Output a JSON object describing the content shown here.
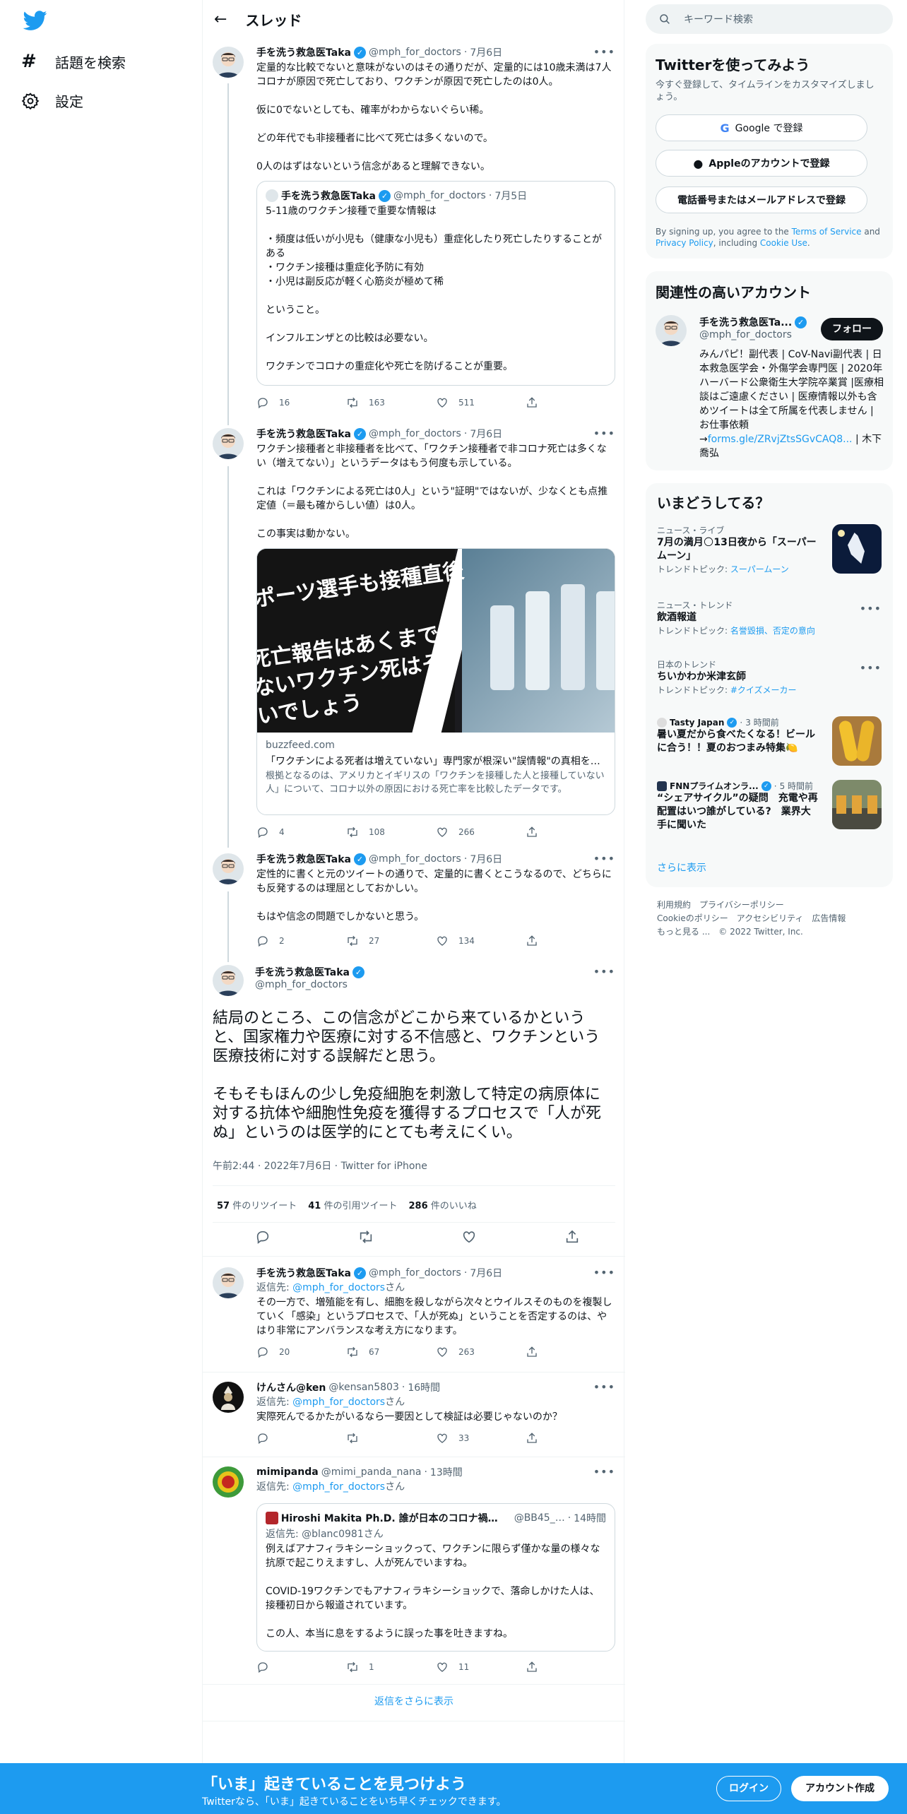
{
  "sidebar": {
    "explore_label": "話題を検索",
    "settings_label": "設定"
  },
  "header": {
    "title": "スレッド"
  },
  "search": {
    "placeholder": "キーワード検索"
  },
  "tweets": [
    {
      "name": "手を洗う救急医Taka",
      "handle": "@mph_for_doctors",
      "date": "7月6日",
      "text": "定量的な比較でないと意味がないのはその通りだが、定量的には10歳未満は7人コロナが原因で死亡しており、ワクチンが原因で死亡したのは0人。\n\n仮に0でないとしても、確率がわからないぐらい稀。\n\nどの年代でも非接種者に比べて死亡は多くないので。\n\n0人のはずはないという信念があると理解できない。",
      "quote": {
        "name": "手を洗う救急医Taka",
        "handle": "@mph_for_doctors",
        "date": "7月5日",
        "text": "5-11歳のワクチン接種で重要な情報は\n\n・頻度は低いが小児も（健康な小児も）重症化したり死亡したりすることがある\n・ワクチン接種は重症化予防に有効\n・小児は副反応が軽く心筋炎が極めて稀\n\nということ。\n\nインフルエンザとの比較は必要ない。\n\nワクチンでコロナの重症化や死亡を防げることが重要。"
      },
      "replies": "16",
      "retweets": "163",
      "likes": "511"
    },
    {
      "name": "手を洗う救急医Taka",
      "handle": "@mph_for_doctors",
      "date": "7月6日",
      "text": "ワクチン接種者と非接種者を比べて、「ワクチン接種者で非コロナ死亡は多くない（増えてない）」というデータはもう何度も示している。\n\nこれは「ワクチンによる死亡は0人」という\"証明\"ではないが、少なくとも点推定値（＝最も確からしい値）は0人。\n\nこの事実は動かない。",
      "card": {
        "domain": "buzzfeed.com",
        "title": "「ワクチンによる死者は増えていない」専門家が根深い\"誤情報\"の真相を解説",
        "desc": "根拠となるのは、アメリカとイギリスの「ワクチンを接種した人と接種していない人」について、コロナ以外の原因における死亡率を比較したデータです。",
        "img_text_1": "ポーツ選手も接種直後",
        "img_text_2": "死亡報告はあくまで\nないワクチン死はそ\nいでしょう"
      },
      "replies": "4",
      "retweets": "108",
      "likes": "266"
    },
    {
      "name": "手を洗う救急医Taka",
      "handle": "@mph_for_doctors",
      "date": "7月6日",
      "text": "定性的に書くと元のツイートの通りで、定量的に書くとこうなるので、どちらにも反発するのは理屈としておかしい。\n\nもはや信念の問題でしかないと思う。",
      "replies": "2",
      "retweets": "27",
      "likes": "134"
    }
  ],
  "main_tweet": {
    "name": "手を洗う救急医Taka",
    "handle": "@mph_for_doctors",
    "text": "結局のところ、この信念がどこから来ているかというと、国家権力や医療に対する不信感と、ワクチンという医療技術に対する誤解だと思う。\n\nそもそもほんの少し免疫細胞を刺激して特定の病原体に対する抗体や細胞性免疫を獲得するプロセスで「人が死ぬ」というのは医学的にとても考えにくい。",
    "meta": "午前2:44 · 2022年7月6日 · Twitter for iPhone",
    "retweets": "57",
    "retweets_label": "件のリツイート",
    "quotes": "41",
    "quotes_label": "件の引用ツイート",
    "likes": "286",
    "likes_label": "件のいいね"
  },
  "replies": [
    {
      "name": "手を洗う救急医Taka",
      "handle": "@mph_for_doctors",
      "date": "7月6日",
      "reply_prefix": "返信先: ",
      "reply_to": "@mph_for_doctors",
      "reply_suffix": "さん",
      "text": "その一方で、増殖能を有し、細胞を殺しながら次々とウイルスそのものを複製していく「感染」というプロセスで、「人が死ぬ」ということを否定するのは、やはり非常にアンバランスな考え方になります。",
      "replies": "20",
      "retweets": "67",
      "likes": "263"
    },
    {
      "name": "けんさん@ken",
      "handle": "@kensan5803",
      "date": "16時間",
      "reply_prefix": "返信先: ",
      "reply_to": "@mph_for_doctors",
      "reply_suffix": "さん",
      "text": "実際死んでるかたがいるなら一要因として検証は必要じゃないのか？",
      "replies": "",
      "retweets": "",
      "likes": "33"
    },
    {
      "name": "mimipanda",
      "handle": "@mimi_panda_nana",
      "date": "13時間",
      "reply_prefix": "返信先: ",
      "reply_to": "@mph_for_doctors",
      "reply_suffix": "さん",
      "quote": {
        "name": "Hiroshi Makita Ph.D. 誰が日本のコロナ禍を…",
        "handle": "@BB45_…",
        "date": "14時間",
        "reply_line": "返信先: @blanc0981さん",
        "text": "例えばアナフィラキシーショックって、ワクチンに限らず僅かな量の様々な抗原で起こりえますし、人が死んでいますね。\n\nCOVID-19ワクチンでもアナフィラキシーショックで、落命しかけた人は、接種初日から報道されています。\n\nこの人、本当に息をするように誤った事を吐きますね。"
      },
      "replies": "",
      "retweets": "1",
      "likes": "11"
    }
  ],
  "show_more_replies": "返信をさらに表示",
  "signup": {
    "title": "Twitterを使ってみよう",
    "subtitle": "今すぐ登録して、タイムラインをカスタマイズしましょう。",
    "google": "Google で登録",
    "apple": "Appleのアカウントで登録",
    "phone": "電話番号またはメールアドレスで登録",
    "terms_pre": "By signing up, you agree to the ",
    "terms_tos": "Terms of Service",
    "terms_and": " and ",
    "terms_privacy": "Privacy Policy",
    "terms_including": ", including ",
    "terms_cookie": "Cookie Use",
    "terms_end": "."
  },
  "related": {
    "title": "関連性の高いアカウント",
    "name": "手を洗う救急医Ta...",
    "handle": "@mph_for_doctors",
    "follow": "フォロー",
    "bio_1": "みんパピ！副代表 | CoV-Navi副代表 | 日本救急医学会・外傷学会専門医 | 2020年ハーバード公衆衛生大学院卒業賞 |医療相談はご遠慮ください | 医療情報以外も含めツイートは全て所属を代表しません | お仕事依頼→",
    "bio_link": "forms.gle/ZRvjZtsSGvCAQ8...",
    "bio_2": " | 木下喬弘"
  },
  "trends": {
    "title": "いまどうしてる？",
    "items": [
      {
        "category": "ニュース・ライブ",
        "title": "7月の満月🌕13日夜から「スーパームーン」",
        "topic_label": "トレンドトピック: ",
        "topic": "スーパームーン"
      },
      {
        "category": "ニュース・トレンド",
        "title": "飲酒報道",
        "topic_label": "トレンドトピック: ",
        "topic": "名誉毀損、否定の意向"
      },
      {
        "category": "日本のトレンド",
        "title": "ちいかわか米津玄師",
        "topic_label": "トレンドトピック: ",
        "topic": "#クイズメーカー"
      },
      {
        "source": "Tasty Japan",
        "time": "3 時間前",
        "title": "暑い夏だから食べたくなる！ビールに合う！！夏のおつまみ特集🍋"
      },
      {
        "source": "FNNプライムオンラ...",
        "time": "5 時間前",
        "title": "“シェアサイクル”の疑問　充電や再配置はいつ誰がしている?　業界大手に聞いた"
      }
    ],
    "show_more": "さらに表示"
  },
  "footer": {
    "links_1": "利用規約　プライバシーポリシー",
    "links_2": "Cookieのポリシー　アクセシビリティ　広告情報",
    "links_3": "もっと見る ...　© 2022 Twitter, Inc."
  },
  "bottom": {
    "title": "「いま」起きていることを見つけよう",
    "subtitle": "Twitterなら、「いま」起きていることをいち早くチェックできます。",
    "login": "ログイン",
    "signup": "アカウント作成"
  },
  "colors": {
    "accent": "#1d9bf0",
    "text": "#0f1419",
    "muted": "#536471"
  }
}
